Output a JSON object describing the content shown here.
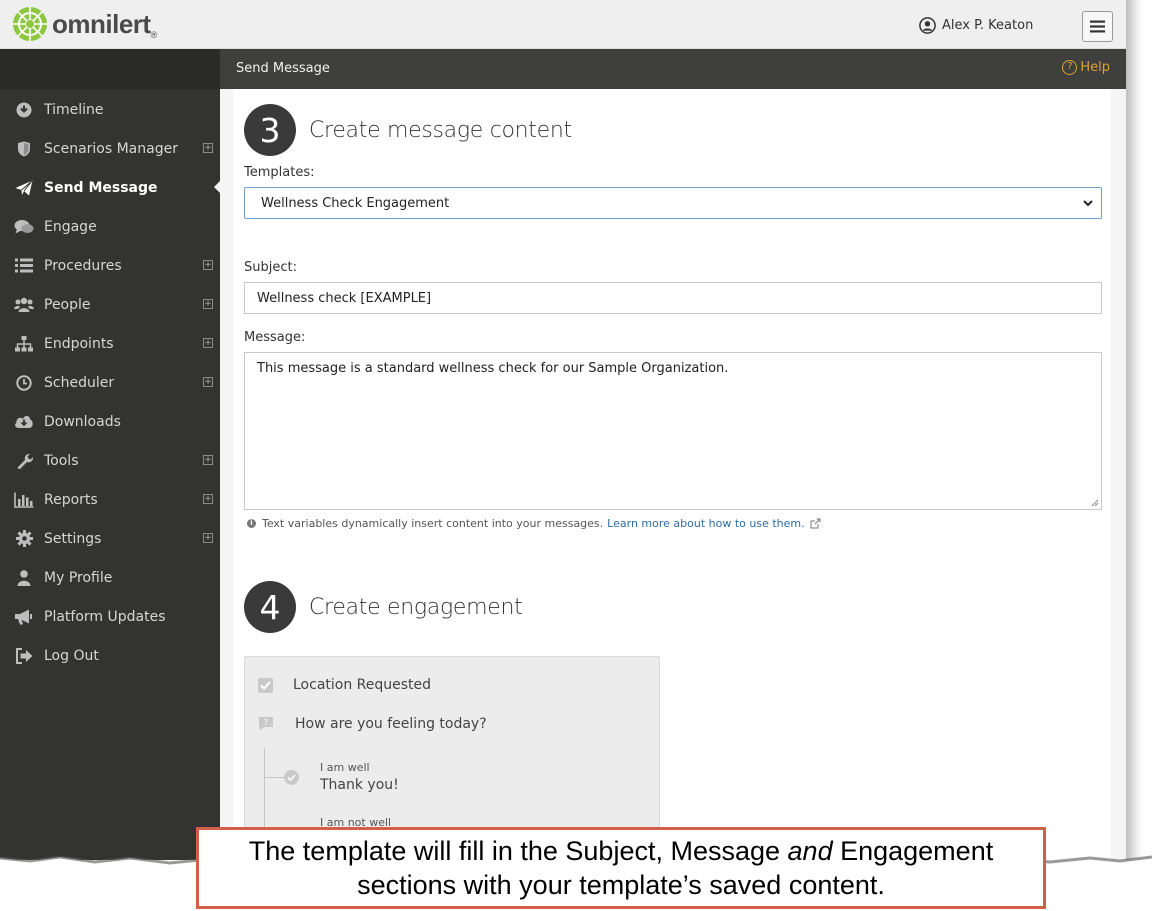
{
  "app": {
    "brand": "omnilert",
    "brand_mark": "®",
    "user_name": "Alex P. Keaton"
  },
  "header": {
    "title": "Send Message",
    "help_label": "Help"
  },
  "sidebar": {
    "items": [
      {
        "label": "Timeline",
        "icon": "timeline-icon",
        "expandable": false
      },
      {
        "label": "Scenarios Manager",
        "icon": "shield-icon",
        "expandable": true
      },
      {
        "label": "Send Message",
        "icon": "paper-plane-icon",
        "expandable": false,
        "active": true
      },
      {
        "label": "Engage",
        "icon": "chat-icon",
        "expandable": false
      },
      {
        "label": "Procedures",
        "icon": "list-icon",
        "expandable": true
      },
      {
        "label": "People",
        "icon": "people-icon",
        "expandable": true
      },
      {
        "label": "Endpoints",
        "icon": "sitemap-icon",
        "expandable": true
      },
      {
        "label": "Scheduler",
        "icon": "clock-icon",
        "expandable": true
      },
      {
        "label": "Downloads",
        "icon": "cloud-download-icon",
        "expandable": false
      },
      {
        "label": "Tools",
        "icon": "wrench-icon",
        "expandable": true
      },
      {
        "label": "Reports",
        "icon": "bar-chart-icon",
        "expandable": true
      },
      {
        "label": "Settings",
        "icon": "gear-icon",
        "expandable": true
      },
      {
        "label": "My Profile",
        "icon": "user-icon",
        "expandable": false
      },
      {
        "label": "Platform Updates",
        "icon": "megaphone-icon",
        "expandable": false
      },
      {
        "label": "Log Out",
        "icon": "logout-icon",
        "expandable": false
      }
    ]
  },
  "step3": {
    "number": "3",
    "title": "Create message content",
    "templates_label": "Templates:",
    "template_selected": "Wellness Check Engagement",
    "subject_label": "Subject:",
    "subject_value": "Wellness check [EXAMPLE]",
    "message_label": "Message:",
    "message_value": "This message is a standard wellness check for our Sample Organization.",
    "hint_text": "Text variables dynamically insert content into your messages.",
    "hint_link": "Learn more about how to use them."
  },
  "step4": {
    "number": "4",
    "title": "Create engagement",
    "location_label": "Location Requested",
    "question": "How are you feeling today?",
    "answers": [
      {
        "option": "I am well",
        "reply": "Thank you!"
      },
      {
        "option": "I am not well"
      }
    ]
  },
  "callout": {
    "line1_before": "The template will fill in the Subject, Message ",
    "line1_emph": "and",
    "line1_after": " Engagement",
    "line2": "sections with your template’s saved content."
  },
  "colors": {
    "sidebar_bg": "#333331",
    "header_bg": "#3f3f3d",
    "help": "#d9a23a",
    "logo_green": "#8dc63f",
    "callout_border": "#d25f4a",
    "link": "#2e6da4"
  }
}
